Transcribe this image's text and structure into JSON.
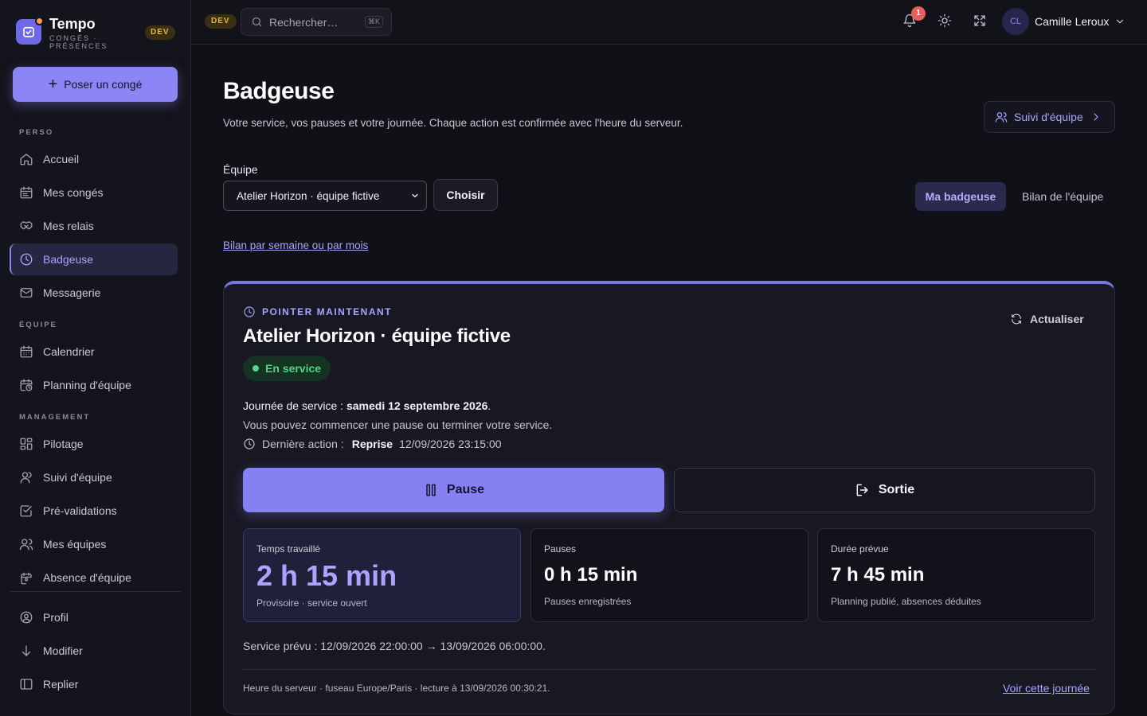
{
  "brand": {
    "title": "Tempo",
    "subtitle": "CONGÉS · PRÉSENCES",
    "env_badge": "DEV"
  },
  "sidebar": {
    "cta_label": "Poser un congé",
    "sections": {
      "perso": "PERSO",
      "equipe": "ÉQUIPE",
      "management": "MANAGEMENT"
    },
    "items": [
      {
        "label": "Accueil",
        "icon": "home-icon"
      },
      {
        "label": "Mes congés",
        "icon": "calendar-list-icon"
      },
      {
        "label": "Mes relais",
        "icon": "handshake-icon"
      },
      {
        "label": "Badgeuse",
        "icon": "clock-icon",
        "active": true
      },
      {
        "label": "Messagerie",
        "icon": "mail-icon"
      },
      {
        "label": "Calendrier",
        "icon": "calendar-icon"
      },
      {
        "label": "Planning d'équipe",
        "icon": "calendar-clock-icon"
      },
      {
        "label": "Pilotage",
        "icon": "dashboard-icon"
      },
      {
        "label": "Suivi d'équipe",
        "icon": "user-icon"
      },
      {
        "label": "Pré-validations",
        "icon": "check-square-icon"
      },
      {
        "label": "Mes équipes",
        "icon": "users-icon"
      },
      {
        "label": "Absence d'équipe",
        "icon": "calendar-user-icon"
      }
    ],
    "bottom": [
      {
        "label": "Profil",
        "icon": "profile-icon"
      },
      {
        "label": "Modifier",
        "icon": "arrow-down-icon"
      },
      {
        "label": "Replier",
        "icon": "sidebar-collapse-icon"
      }
    ]
  },
  "topbar": {
    "env_badge": "DEV",
    "search_placeholder": "Rechercher…",
    "search_shortcut": "⌘K",
    "notification_count": "1",
    "user": {
      "initials": "CL",
      "name": "Camille Leroux"
    }
  },
  "page": {
    "title": "Badgeuse",
    "subtitle": "Votre service, vos pauses et votre journée. Chaque action est confirmée avec l'heure du serveur.",
    "follow_button": "Suivi d'équipe",
    "team_label": "Équipe",
    "team_selected": "Atelier Horizon · équipe fictive",
    "choose_button": "Choisir",
    "tabs": {
      "active": "Ma badgeuse",
      "inactive": "Bilan de l'équipe"
    },
    "report_link": "Bilan par semaine ou par mois"
  },
  "card": {
    "eyebrow": "POINTER MAINTENANT",
    "refresh": "Actualiser",
    "title": "Atelier Horizon · équipe fictive",
    "status": "En service",
    "status_color": "#4fd68a",
    "journee_prefix": "Journée de service : ",
    "journee_date": "samedi 12 septembre 2026",
    "journee_suffix": ".",
    "hint": "Vous pouvez commencer une pause ou terminer votre service.",
    "last_action_label": "Dernière action :",
    "last_action_type": "Reprise",
    "last_action_time": "12/09/2026 23:15:00",
    "pause_button": "Pause",
    "exit_button": "Sortie",
    "stats": [
      {
        "label": "Temps travaillé",
        "value": "2 h 15 min",
        "note": "Provisoire · service ouvert"
      },
      {
        "label": "Pauses",
        "value": "0 h 15 min",
        "note": "Pauses enregistrées"
      },
      {
        "label": "Durée prévue",
        "value": "7 h 45 min",
        "note": "Planning publié, absences déduites"
      }
    ],
    "service_prevu": "Service prévu : 12/09/2026 22:00:00 → 13/09/2026 06:00:00.",
    "footnote": "Heure du serveur · fuseau Europe/Paris · lecture à 13/09/2026 00:30:21.",
    "day_link": "Voir cette journée"
  },
  "colors": {
    "accent": "#8b85f5",
    "background": "#101017",
    "success": "#4fd68a",
    "warning_badge": "#e3b54a",
    "notification": "#e5605a"
  }
}
